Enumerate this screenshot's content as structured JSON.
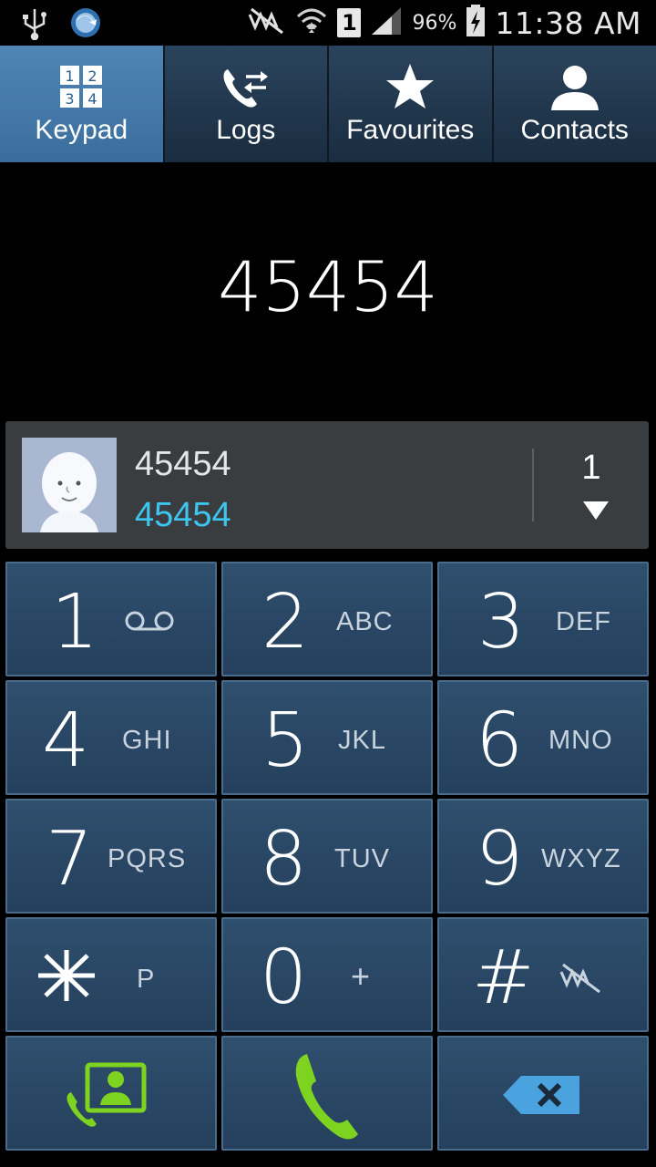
{
  "status_bar": {
    "battery": "96%",
    "sim": "1",
    "time": "11:38 AM",
    "icons": [
      "usb-icon",
      "sync-icon",
      "mute-icon",
      "wifi-icon",
      "signal-icon",
      "battery-charging-icon"
    ]
  },
  "tabs": [
    {
      "label": "Keypad",
      "icon": "keypad-icon",
      "active": true
    },
    {
      "label": "Logs",
      "icon": "logs-icon",
      "active": false
    },
    {
      "label": "Favourites",
      "icon": "star-icon",
      "active": false
    },
    {
      "label": "Contacts",
      "icon": "contact-icon",
      "active": false
    }
  ],
  "dialed_number": "45454",
  "suggestion": {
    "name": "45454",
    "number": "45454",
    "count": "1"
  },
  "keys": [
    {
      "digit": "1",
      "letters": "",
      "extra_icon": "voicemail-icon"
    },
    {
      "digit": "2",
      "letters": "ABC"
    },
    {
      "digit": "3",
      "letters": "DEF"
    },
    {
      "digit": "4",
      "letters": "GHI"
    },
    {
      "digit": "5",
      "letters": "JKL"
    },
    {
      "digit": "6",
      "letters": "MNO"
    },
    {
      "digit": "7",
      "letters": "PQRS"
    },
    {
      "digit": "8",
      "letters": "TUV"
    },
    {
      "digit": "9",
      "letters": "WXYZ"
    },
    {
      "digit": "*",
      "letters": "P"
    },
    {
      "digit": "0",
      "letters": "+"
    },
    {
      "digit": "#",
      "letters": "",
      "extra_icon": "mute-icon"
    }
  ],
  "actions": [
    "add-to-contacts-icon",
    "call-icon",
    "backspace-icon"
  ],
  "colors": {
    "active_tab": "#3a6d9c",
    "key_bg": "#2a4766",
    "suggestion_number": "#3cc6ef",
    "call_green": "#7ed321"
  }
}
